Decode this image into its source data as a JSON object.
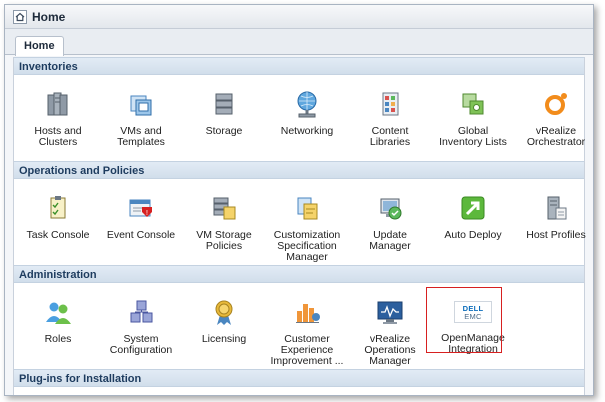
{
  "window": {
    "title": "Home",
    "tab": "Home"
  },
  "sections": [
    {
      "title": "Inventories",
      "items": [
        {
          "label": "Hosts and\nClusters",
          "icon": "hosts-clusters-icon"
        },
        {
          "label": "VMs and\nTemplates",
          "icon": "vms-templates-icon"
        },
        {
          "label": "Storage",
          "icon": "storage-icon"
        },
        {
          "label": "Networking",
          "icon": "networking-icon"
        },
        {
          "label": "Content\nLibraries",
          "icon": "content-libraries-icon"
        },
        {
          "label": "Global\nInventory Lists",
          "icon": "global-inventory-icon"
        },
        {
          "label": "vRealize\nOrchestrator",
          "icon": "orchestrator-icon"
        }
      ]
    },
    {
      "title": "Operations and Policies",
      "items": [
        {
          "label": "Task Console",
          "icon": "task-console-icon"
        },
        {
          "label": "Event Console",
          "icon": "event-console-icon"
        },
        {
          "label": "VM Storage\nPolicies",
          "icon": "vm-storage-policies-icon"
        },
        {
          "label": "Customization\nSpecification\nManager",
          "icon": "customization-icon"
        },
        {
          "label": "Update\nManager",
          "icon": "update-manager-icon"
        },
        {
          "label": "Auto Deploy",
          "icon": "auto-deploy-icon"
        },
        {
          "label": "Host Profiles",
          "icon": "host-profiles-icon"
        }
      ]
    },
    {
      "title": "Administration",
      "items": [
        {
          "label": "Roles",
          "icon": "roles-icon"
        },
        {
          "label": "System\nConfiguration",
          "icon": "system-configuration-icon"
        },
        {
          "label": "Licensing",
          "icon": "licensing-icon"
        },
        {
          "label": "Customer\nExperience\nImprovement ...",
          "icon": "ceip-icon"
        },
        {
          "label": "vRealize\nOperations\nManager",
          "icon": "operations-manager-icon"
        },
        {
          "label": "OpenManage\nIntegration",
          "icon": "dell-emc-logo-icon",
          "logo_line1": "DELL",
          "logo_line2": "EMC"
        }
      ]
    },
    {
      "title": "Plug-ins for Installation",
      "items": []
    }
  ],
  "colors": {
    "highlight": "#d72020",
    "section_text": "#1d3b5e"
  }
}
